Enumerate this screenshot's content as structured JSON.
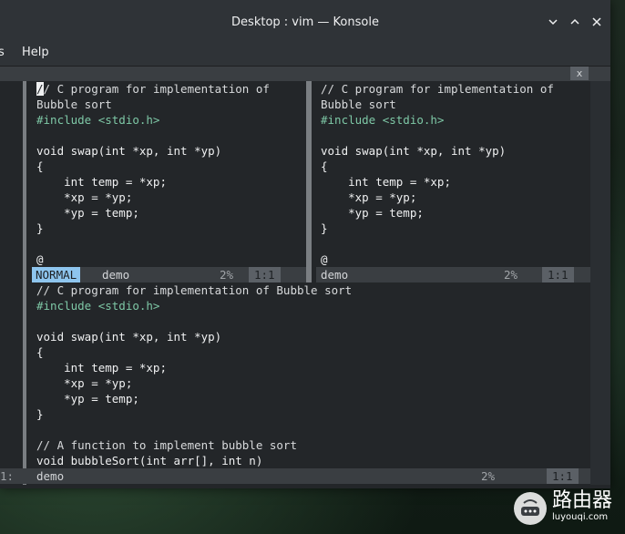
{
  "window": {
    "title": "Desktop : vim — Konsole"
  },
  "menu": {
    "items": [
      "s",
      "Help"
    ]
  },
  "tab": {
    "close_label": "x"
  },
  "panes": {
    "top_left": {
      "lines": [
        {
          "t": "// C program for implementation of",
          "c": "cmt",
          "cursor": true
        },
        {
          "t": "Bubble sort",
          "c": "cmt"
        },
        {
          "t": "#include <stdio.h>",
          "c": "pp"
        },
        {
          "t": "",
          "c": ""
        },
        {
          "t": "void swap(int *xp, int *yp)",
          "c": ""
        },
        {
          "t": "{",
          "c": ""
        },
        {
          "t": "    int temp = *xp;",
          "c": ""
        },
        {
          "t": "    *xp = *yp;",
          "c": ""
        },
        {
          "t": "    *yp = temp;",
          "c": ""
        },
        {
          "t": "}",
          "c": ""
        },
        {
          "t": "",
          "c": ""
        },
        {
          "t": "@",
          "c": ""
        }
      ],
      "status": {
        "mode": "NORMAL",
        "file": "demo",
        "percent": "2%",
        "position": "1:1"
      }
    },
    "top_right": {
      "lines": [
        {
          "t": "// C program for implementation of",
          "c": "cmt"
        },
        {
          "t": "Bubble sort",
          "c": "cmt"
        },
        {
          "t": "#include <stdio.h>",
          "c": "pp"
        },
        {
          "t": "",
          "c": ""
        },
        {
          "t": "void swap(int *xp, int *yp)",
          "c": ""
        },
        {
          "t": "{",
          "c": ""
        },
        {
          "t": "    int temp = *xp;",
          "c": ""
        },
        {
          "t": "    *xp = *yp;",
          "c": ""
        },
        {
          "t": "    *yp = temp;",
          "c": ""
        },
        {
          "t": "}",
          "c": ""
        },
        {
          "t": "",
          "c": ""
        },
        {
          "t": "@",
          "c": ""
        }
      ],
      "status": {
        "file": "demo",
        "percent": "2%",
        "position": "1:1"
      }
    },
    "bottom": {
      "lines": [
        {
          "t": "// C program for implementation of Bubble sort",
          "c": "cmt"
        },
        {
          "t": "#include <stdio.h>",
          "c": "pp"
        },
        {
          "t": "",
          "c": ""
        },
        {
          "t": "void swap(int *xp, int *yp)",
          "c": ""
        },
        {
          "t": "{",
          "c": ""
        },
        {
          "t": "    int temp = *xp;",
          "c": ""
        },
        {
          "t": "    *xp = *yp;",
          "c": ""
        },
        {
          "t": "    *yp = temp;",
          "c": ""
        },
        {
          "t": "}",
          "c": ""
        },
        {
          "t": "",
          "c": ""
        },
        {
          "t": "// A function to implement bubble sort",
          "c": "cmt"
        },
        {
          "t": "void bubbleSort(int arr[], int n)",
          "c": ""
        }
      ],
      "status": {
        "file": "demo",
        "percent": "2%",
        "position": "1:1",
        "left_fragment": "1:"
      }
    }
  },
  "watermark": {
    "brand_cn": "路由器",
    "brand_url": "luyouqi.com"
  }
}
